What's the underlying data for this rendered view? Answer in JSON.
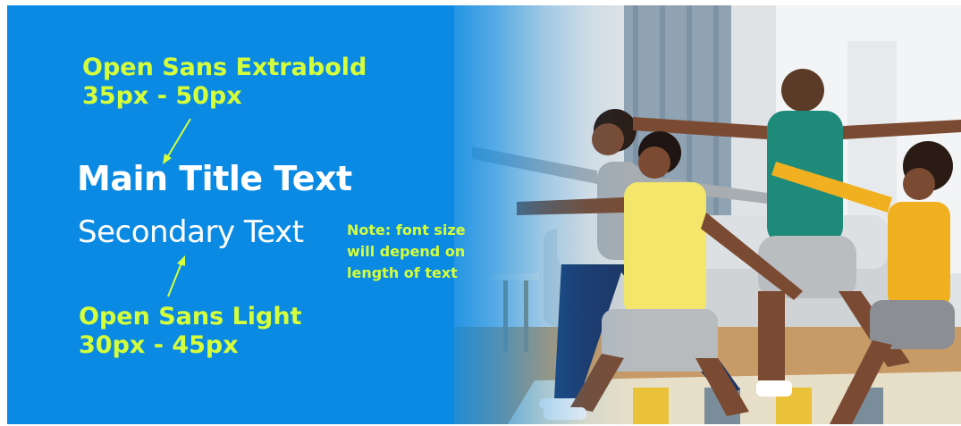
{
  "banner": {
    "top_spec": {
      "font_name": "Open Sans Extrabold",
      "size_range": "35px - 50px"
    },
    "main_title": "Main Title Text",
    "secondary_text": "Secondary Text",
    "bottom_spec": {
      "font_name": "Open Sans Light",
      "size_range": "30px - 45px"
    },
    "note": {
      "line1": "Note: font size",
      "line2": "will depend on",
      "line3": "length of text"
    }
  },
  "colors": {
    "banner_blue": "#0a8ae3",
    "annotation_green": "#d5ff3a",
    "title_white": "#ffffff"
  },
  "image": {
    "photo_icon": "family-yoga-photo-icon"
  }
}
